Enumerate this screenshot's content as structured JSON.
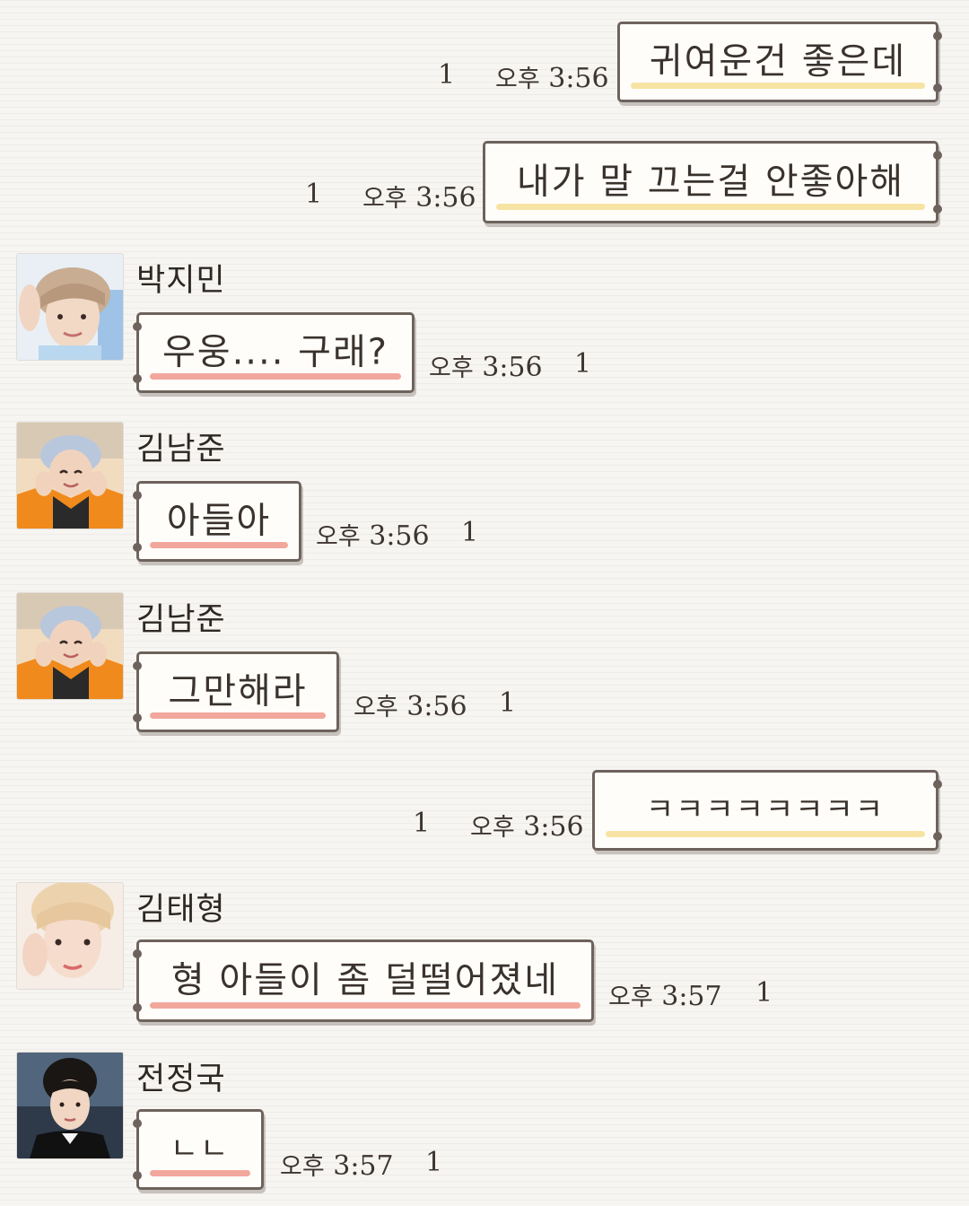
{
  "colors": {
    "background": "#f7f5f2",
    "bubble_border": "#6e635c",
    "incoming_underline": "#f2a79c",
    "outgoing_underline": "#f7e3a3"
  },
  "messages": [
    {
      "direction": "outgoing",
      "text": "귀여운건 좋은데",
      "ampm": "오후",
      "time": "3:56",
      "unread": "1"
    },
    {
      "direction": "outgoing",
      "text": "내가 말 끄는걸 안좋아해",
      "ampm": "오후",
      "time": "3:56",
      "unread": "1"
    },
    {
      "direction": "incoming",
      "sender": "박지민",
      "avatar_icon": "profile-photo-icon",
      "text": "우웅.... 구래?",
      "ampm": "오후",
      "time": "3:56",
      "unread": "1"
    },
    {
      "direction": "incoming",
      "sender": "김남준",
      "avatar_icon": "profile-photo-icon",
      "text": "아들아",
      "ampm": "오후",
      "time": "3:56",
      "unread": "1"
    },
    {
      "direction": "incoming",
      "sender": "김남준",
      "avatar_icon": "profile-photo-icon",
      "text": "그만해라",
      "ampm": "오후",
      "time": "3:56",
      "unread": "1"
    },
    {
      "direction": "outgoing",
      "text": "ㅋㅋㅋㅋㅋㅋㅋㅋ",
      "ampm": "오후",
      "time": "3:56",
      "unread": "1"
    },
    {
      "direction": "incoming",
      "sender": "김태형",
      "avatar_icon": "profile-photo-icon",
      "text": "형 아들이 좀 덜떨어졌네",
      "ampm": "오후",
      "time": "3:57",
      "unread": "1"
    },
    {
      "direction": "incoming",
      "sender": "전정국",
      "avatar_icon": "profile-photo-icon",
      "text": "ㄴㄴ",
      "ampm": "오후",
      "time": "3:57",
      "unread": "1"
    }
  ]
}
